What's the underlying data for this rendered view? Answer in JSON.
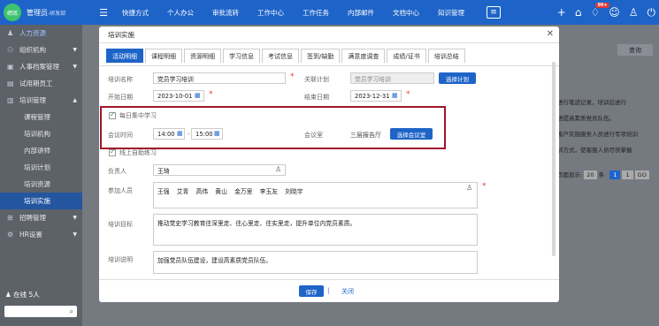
{
  "topbar": {
    "logo": "绩效",
    "user": "管理员",
    "org": "-研发部",
    "nav": [
      "快捷方式",
      "个人办公",
      "审批流转",
      "工作中心",
      "工作任务",
      "内部邮件",
      "文档中心",
      "知识管理"
    ],
    "badge": "99+"
  },
  "sidebar": {
    "items": [
      {
        "label": "人力资源",
        "icon": "person-icon",
        "type": "head"
      },
      {
        "label": "组织机构",
        "icon": "org-icon",
        "type": "group"
      },
      {
        "label": "人事档案管理",
        "icon": "file-icon",
        "type": "group"
      },
      {
        "label": "试用期员工",
        "icon": "doc-icon",
        "type": "group"
      },
      {
        "label": "培训管理",
        "icon": "train-icon",
        "type": "group-open"
      },
      {
        "label": "课程管理",
        "type": "sub"
      },
      {
        "label": "培训机构",
        "type": "sub"
      },
      {
        "label": "内部讲师",
        "type": "sub"
      },
      {
        "label": "培训计划",
        "type": "sub"
      },
      {
        "label": "培训资源",
        "type": "sub"
      },
      {
        "label": "培训实施",
        "type": "sub-active"
      },
      {
        "label": "招聘管理",
        "icon": "recruit-icon",
        "type": "group"
      },
      {
        "label": "HR设置",
        "icon": "settings-icon",
        "type": "group"
      }
    ],
    "online": "在线 5人"
  },
  "background": {
    "lines": [
      "进行笔迹记录，培训后进行",
      "进提高素质党员队伍。",
      "客户实施服务人员进行专项培训",
      "训方式，使客服人员尽快掌握"
    ],
    "query": "查询",
    "pager_show": "页面显示:",
    "pager_size": "20",
    "pager_unit": "条",
    "pages": [
      "1",
      "1",
      "GO"
    ]
  },
  "modal": {
    "title": "培训实施",
    "tabs": [
      "活动明细",
      "课程明细",
      "资源明细",
      "学习信息",
      "考试信息",
      "签到/缺勤",
      "满意度调查",
      "成绩/证书",
      "培训总结"
    ],
    "name_label": "培训名称",
    "name_value": "党员学习培训",
    "plan_label": "关联计划",
    "plan_value": "党员学习培训",
    "plan_button": "选择计划",
    "start_label": "开始日期",
    "start_value": "2023-10-01",
    "end_label": "结束日期",
    "end_value": "2023-12-31",
    "daily_label": "每日集中学习",
    "time_label": "会议时间",
    "time_start": "14:00",
    "time_sep": "-",
    "time_end": "15:00",
    "room_label": "会议室",
    "room_value": "三层报告厅",
    "room_button": "选择会议室",
    "online_label": "线上自助练习",
    "owner_label": "负责人",
    "owner_value": "王琦",
    "members_label": "参加人员",
    "members": [
      "王强",
      "艾青",
      "高伟",
      "黄山",
      "金万里",
      "李玉友",
      "刘晓宇"
    ],
    "goal_label": "培训目标",
    "goal_value": "推动党史学习教育往深里走、往心里走、往实里走，提升单位内党员素质。",
    "desc_label": "培训说明",
    "desc_value": "加强党员队伍建设，建设高素质党员队伍。",
    "save": "保存",
    "close": "关闭"
  },
  "colors": {
    "primary": "#1e64c8",
    "highlight": "#a0152a",
    "required": "#e53935"
  }
}
